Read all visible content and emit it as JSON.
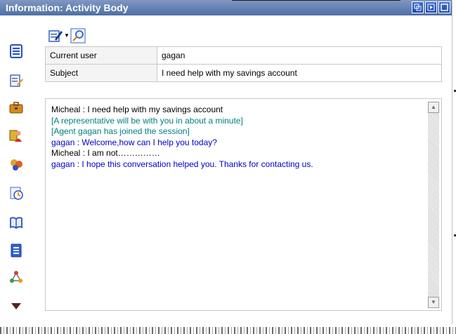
{
  "window": {
    "title": "Information: Activity Body",
    "title_buttons": [
      "restore-icon",
      "popout-icon",
      "maximize-icon"
    ]
  },
  "sidebar": {
    "icons": [
      "document-icon",
      "edit-document-icon",
      "briefcase-icon",
      "contacts-icon",
      "users-icon",
      "history-clock-icon",
      "knowledge-book-icon",
      "list-icon",
      "workflow-icon",
      "more-arrow-icon"
    ]
  },
  "toolbar": {
    "icons": [
      "edit-icon",
      "dropdown-arrow-icon",
      "search-icon"
    ]
  },
  "info": {
    "rows": [
      {
        "label": "Current user",
        "value": "gagan"
      },
      {
        "label": "Subject",
        "value": "I need help with my savings account"
      }
    ]
  },
  "chat": {
    "lines": [
      {
        "text": "Micheal : I need help with my savings account",
        "color": "#000000"
      },
      {
        "text": "[A representative will be with you in about a minute]",
        "color": "#008080"
      },
      {
        "text": "[Agent gagan has joined the session]",
        "color": "#008080"
      },
      {
        "text": "gagan : Welcome,how can I help you today?",
        "color": "#0000cc"
      },
      {
        "text": "Micheal : I am not……………",
        "color": "#000000"
      },
      {
        "text": "gagan : I hope this conversation helped you. Thanks for contacting us.",
        "color": "#0000cc"
      }
    ]
  },
  "colors": {
    "titlebar": "#5a78ad",
    "title_button": "#2a58c0",
    "chat_teal": "#008080",
    "chat_blue": "#0000cc"
  }
}
